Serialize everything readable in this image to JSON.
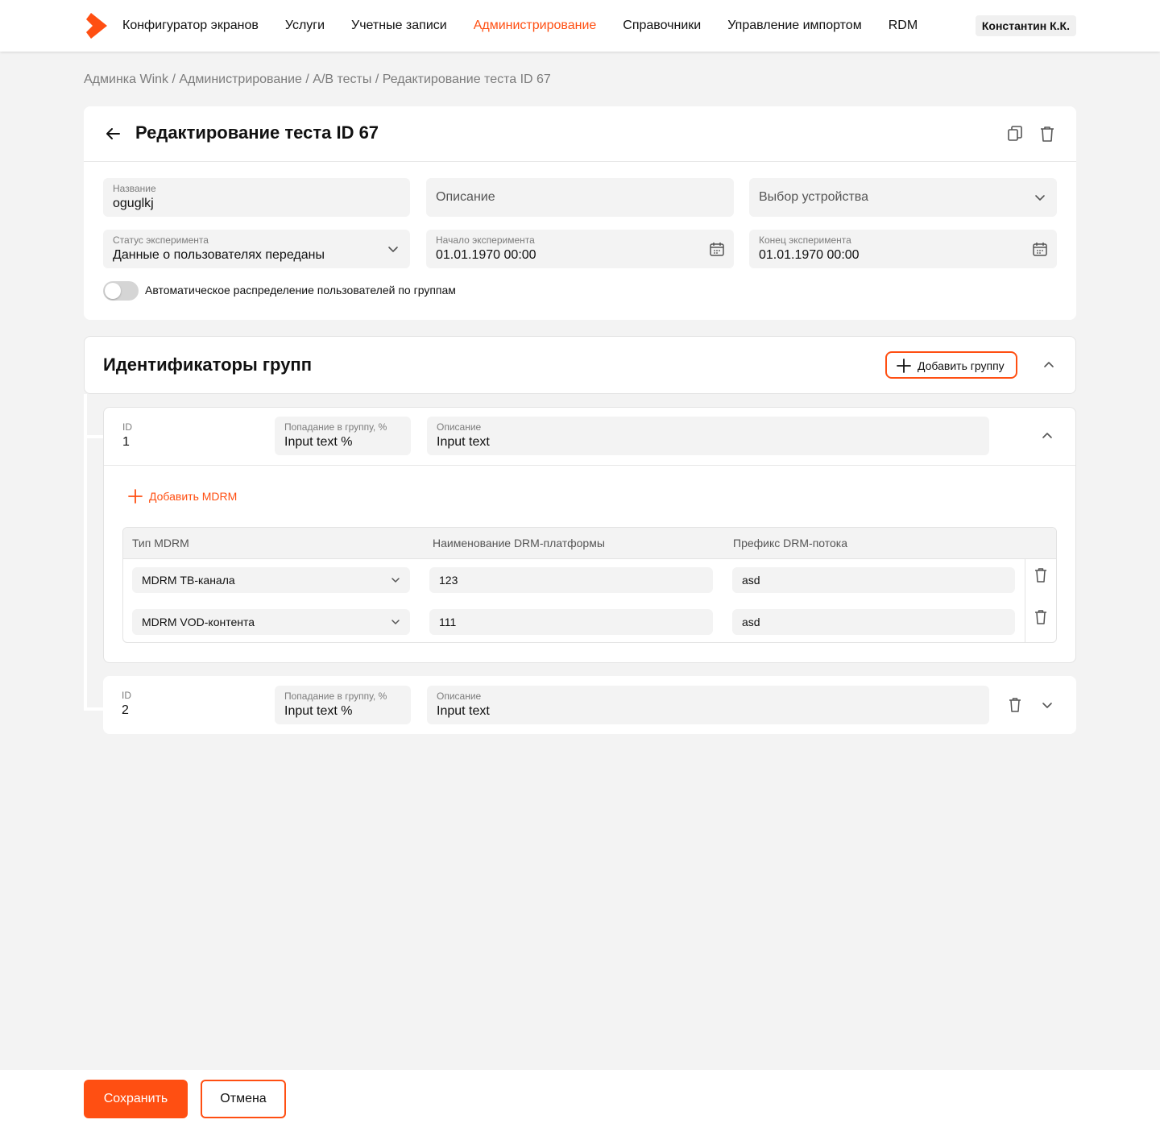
{
  "nav": {
    "logo": "wink-logo",
    "items": [
      {
        "label": "Конфигуратор экранов",
        "active": false
      },
      {
        "label": "Услуги",
        "active": false
      },
      {
        "label": "Учетные записи",
        "active": false
      },
      {
        "label": "Администрирование",
        "active": true
      },
      {
        "label": "Справочники",
        "active": false
      },
      {
        "label": "Управление импортом",
        "active": false
      },
      {
        "label": "RDM",
        "active": false
      }
    ],
    "user": "Константин К.К."
  },
  "breadcrumb": "Админка Wink / Администрирование / A/B тесты / Редактирование теста ID 67",
  "edit": {
    "title": "Редактирование теста ID 67",
    "fields": {
      "name": {
        "label": "Название",
        "value": "oguglkj"
      },
      "description": {
        "placeholder": "Описание"
      },
      "device": {
        "placeholder": "Выбор устройства"
      },
      "status": {
        "label": "Статус эксперимента",
        "value": "Данные о пользователях переданы"
      },
      "start": {
        "label": "Начало эксперимента",
        "value": "01.01.1970 00:00"
      },
      "end": {
        "label": "Конец эксперимента",
        "value": "01.01.1970 00:00"
      }
    },
    "auto_distribution": {
      "label": "Автоматическое распределение пользователей по группам",
      "enabled": false
    }
  },
  "groups": {
    "title": "Идентификаторы групп",
    "add_button": "Добавить группу",
    "items": [
      {
        "id_label": "ID",
        "id": "1",
        "percent_label": "Попадание в группу, %",
        "percent_value": "Input text %",
        "desc_label": "Описание",
        "desc_value": "Input text",
        "add_mdrm": "Добавить MDRM",
        "columns": [
          "Тип MDRM",
          "Наименование DRM-платформы",
          "Префикс DRM-потока"
        ],
        "rows": [
          {
            "type": "MDRM ТВ-канала",
            "platform": "123",
            "prefix": "asd"
          },
          {
            "type": "MDRM VOD-контента",
            "platform": "111",
            "prefix": "asd"
          }
        ]
      },
      {
        "id_label": "ID",
        "id": "2",
        "percent_label": "Попадание в группу, %",
        "percent_value": "Input text %",
        "desc_label": "Описание",
        "desc_value": "Input text"
      }
    ]
  },
  "footer": {
    "save": "Сохранить",
    "cancel": "Отмена"
  },
  "colors": {
    "accent": "#ff4f12",
    "background": "#f3f3f3",
    "field": "#f3f3f3"
  }
}
